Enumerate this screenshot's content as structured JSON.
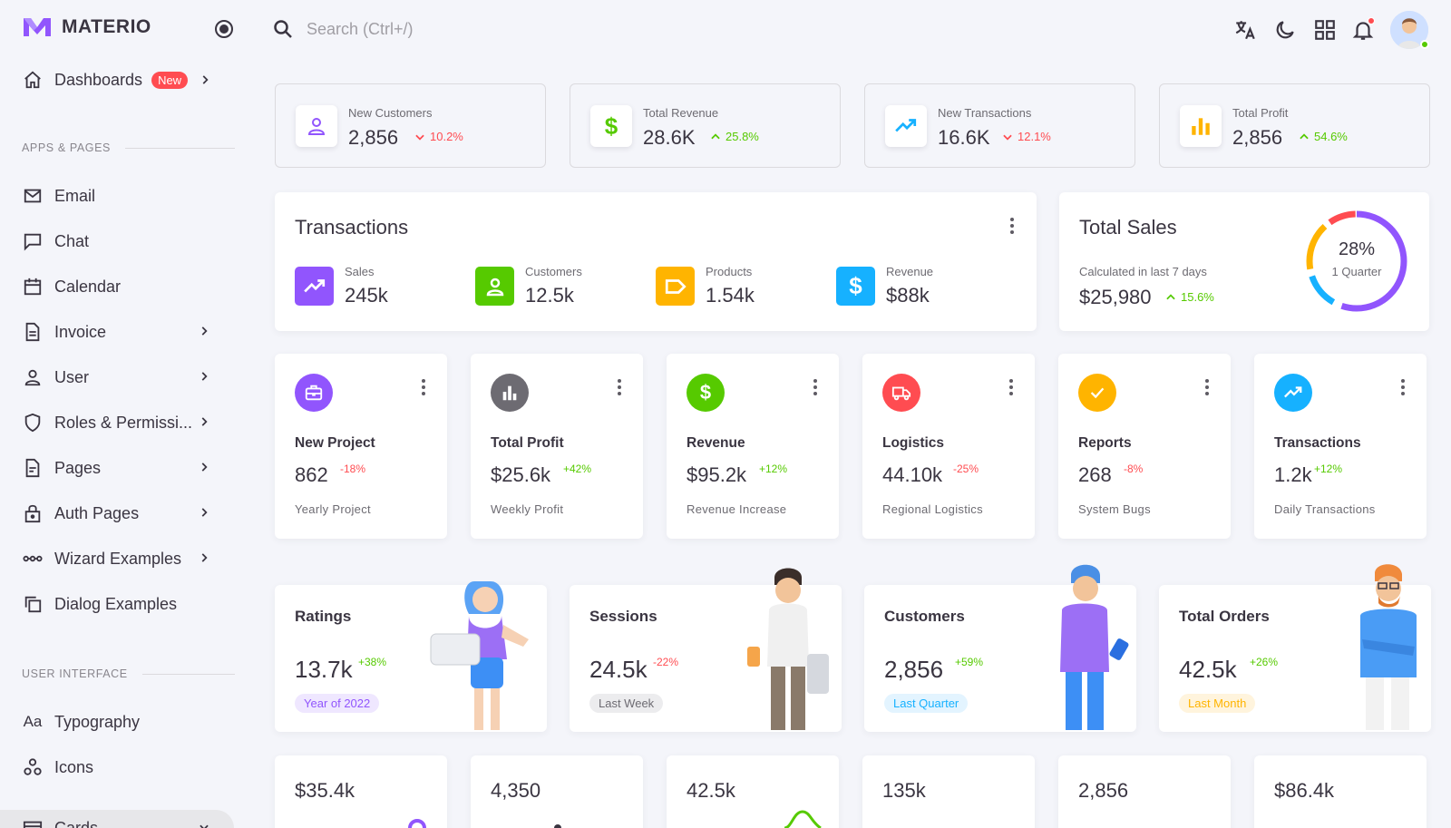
{
  "brand": {
    "name": "MATERIO"
  },
  "search": {
    "placeholder": "Search (Ctrl+/)"
  },
  "sidebar": {
    "dashboards": {
      "label": "Dashboards",
      "badge": "New"
    },
    "section_apps": "APPS & PAGES",
    "items": [
      {
        "label": "Email"
      },
      {
        "label": "Chat"
      },
      {
        "label": "Calendar"
      },
      {
        "label": "Invoice"
      },
      {
        "label": "User"
      },
      {
        "label": "Roles & Permissi..."
      },
      {
        "label": "Pages"
      },
      {
        "label": "Auth Pages"
      },
      {
        "label": "Wizard Examples"
      },
      {
        "label": "Dialog Examples"
      }
    ],
    "section_ui": "USER INTERFACE",
    "ui_items": [
      {
        "label": "Typography",
        "icon_text": "Aa"
      },
      {
        "label": "Icons"
      },
      {
        "label": "Cards"
      }
    ]
  },
  "stats": [
    {
      "title": "New Customers",
      "value": "2,856",
      "change": "10.2%",
      "trend": "down",
      "icon": "user-icon",
      "color": "#9155fd"
    },
    {
      "title": "Total Revenue",
      "value": "28.6K",
      "change": "25.8%",
      "trend": "up",
      "icon": "dollar-icon",
      "color": "#56ca00"
    },
    {
      "title": "New Transactions",
      "value": "16.6K",
      "change": "12.1%",
      "trend": "down",
      "icon": "trending-up-icon",
      "color": "#16b1ff"
    },
    {
      "title": "Total Profit",
      "value": "2,856",
      "change": "54.6%",
      "trend": "up",
      "icon": "bar-chart-icon",
      "color": "#ffb400"
    }
  ],
  "transactions": {
    "title": "Transactions",
    "items": [
      {
        "label": "Sales",
        "value": "245k",
        "color": "#9155fd",
        "icon": "trending-up-icon"
      },
      {
        "label": "Customers",
        "value": "12.5k",
        "color": "#56ca00",
        "icon": "user-icon"
      },
      {
        "label": "Products",
        "value": "1.54k",
        "color": "#ffb400",
        "icon": "label-icon"
      },
      {
        "label": "Revenue",
        "value": "$88k",
        "color": "#16b1ff",
        "icon": "dollar-icon"
      }
    ]
  },
  "total_sales": {
    "title": "Total Sales",
    "subtitle": "Calculated in last 7 days",
    "value": "$25,980",
    "change": "15.6%",
    "donut_percent": "28%",
    "donut_label": "1 Quarter"
  },
  "mini_cards": [
    {
      "title": "New Project",
      "value": "862",
      "change": "-18%",
      "trend": "down",
      "sub": "Yearly Project",
      "color": "#9155fd",
      "icon": "briefcase-icon"
    },
    {
      "title": "Total Profit",
      "value": "$25.6k",
      "change": "+42%",
      "trend": "up",
      "sub": "Weekly Profit",
      "color": "#6d6b72",
      "icon": "bar-chart-icon"
    },
    {
      "title": "Revenue",
      "value": "$95.2k",
      "change": "+12%",
      "trend": "up",
      "sub": "Revenue Increase",
      "color": "#56ca00",
      "icon": "dollar-icon"
    },
    {
      "title": "Logistics",
      "value": "44.10k",
      "change": "-25%",
      "trend": "down",
      "sub": "Regional Logistics",
      "color": "#ff4c51",
      "icon": "truck-icon"
    },
    {
      "title": "Reports",
      "value": "268",
      "change": "-8%",
      "trend": "down",
      "sub": "System Bugs",
      "color": "#ffb400",
      "icon": "check-icon"
    },
    {
      "title": "Transactions",
      "value": "1.2k",
      "change": "+12%",
      "trend": "up",
      "sub": "Daily Transactions",
      "color": "#16b1ff",
      "icon": "trending-up-icon"
    }
  ],
  "character_cards": [
    {
      "title": "Ratings",
      "value": "13.7k",
      "change": "+38%",
      "chip": "Year of 2022",
      "chip_color": "#9155fd",
      "chip_bg": "#efe7ff"
    },
    {
      "title": "Sessions",
      "value": "24.5k",
      "change": "-22%",
      "chip": "Last Week",
      "chip_color": "#6d6b72",
      "chip_bg": "#ececee"
    },
    {
      "title": "Customers",
      "value": "2,856",
      "change": "+59%",
      "chip": "Last Quarter",
      "chip_color": "#16b1ff",
      "chip_bg": "#e3f4ff"
    },
    {
      "title": "Total Orders",
      "value": "42.5k",
      "change": "+26%",
      "chip": "Last Month",
      "chip_color": "#ffb400",
      "chip_bg": "#fff4dd"
    }
  ],
  "bottom_cards": [
    {
      "value": "$35.4k"
    },
    {
      "value": "4,350"
    },
    {
      "value": "42.5k"
    },
    {
      "value": "135k"
    },
    {
      "value": "2,856"
    },
    {
      "value": "$86.4k"
    }
  ]
}
